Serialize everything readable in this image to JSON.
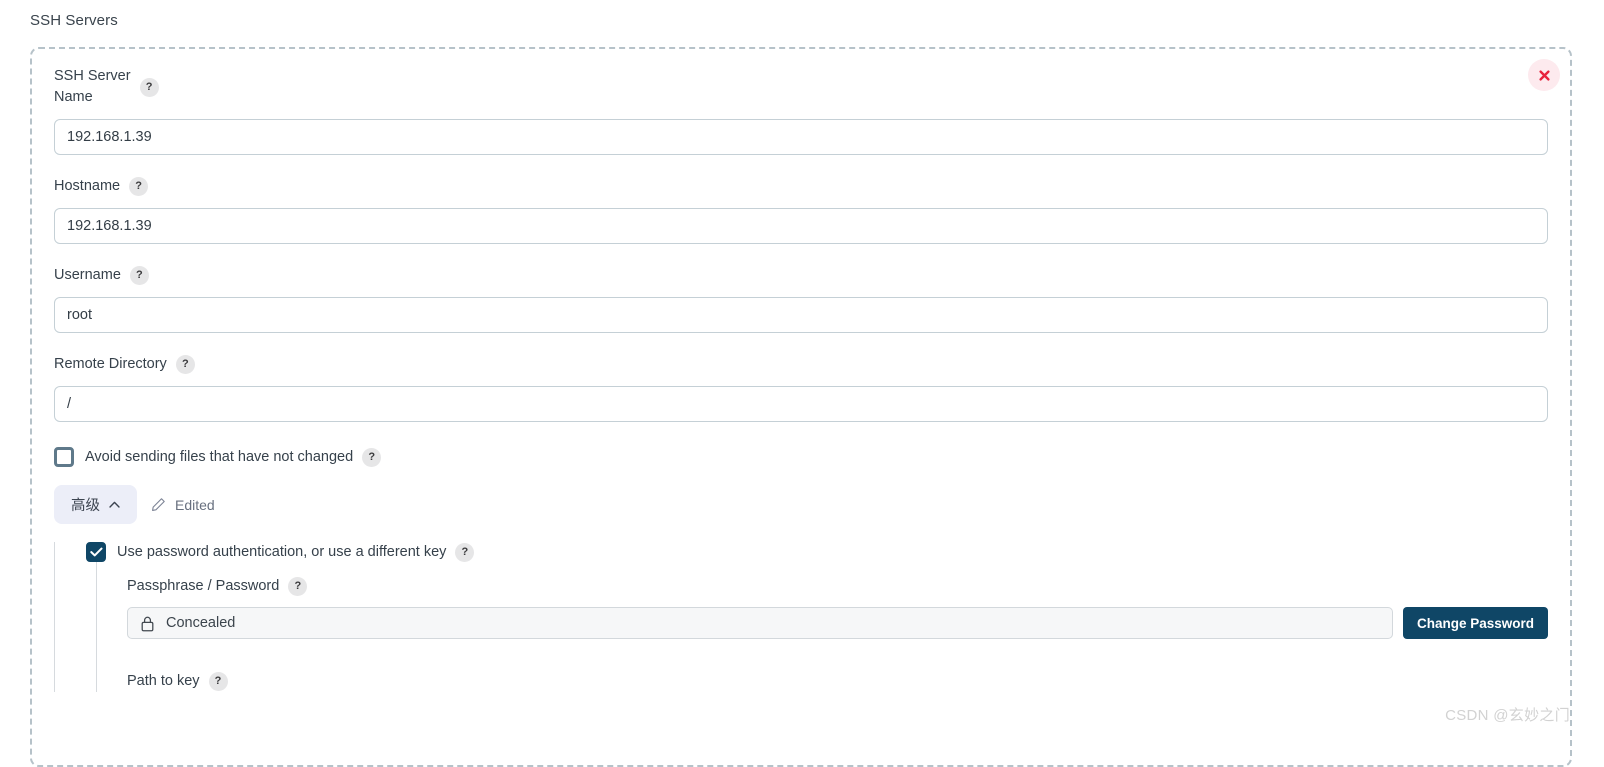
{
  "page": {
    "title": "SSH Servers"
  },
  "colors": {
    "accent_dark": "#0f4666",
    "dashed_border": "#b6c2c9",
    "close_bg": "#fdeaee",
    "close_fg": "#e8213b",
    "advanced_btn_bg": "#eceef8",
    "input_border": "#c5d0d6",
    "help_bg": "#e6e6e7",
    "checkbox_unchecked_border": "#5f798a"
  },
  "panel": {
    "close_label": "×",
    "close_icon": "close-icon",
    "fields": [
      {
        "label": "SSH Server\nName",
        "help": "?",
        "value": "192.168.1.39",
        "placeholder": "",
        "name": "ssh-server-name"
      },
      {
        "label": "Hostname",
        "help": "?",
        "value": "192.168.1.39",
        "placeholder": "",
        "name": "hostname"
      },
      {
        "label": "Username",
        "help": "?",
        "value": "root",
        "placeholder": "",
        "name": "username"
      },
      {
        "label": "Remote Directory",
        "help": "?",
        "value": "/",
        "placeholder": "",
        "name": "remote-directory"
      }
    ],
    "avoid_sending": {
      "label": "Avoid sending files that have not changed",
      "help": "?",
      "checked": false
    },
    "advanced": {
      "button_label": "高级",
      "chevron_icon": "chevron-up-icon",
      "edited_label": "Edited",
      "pencil_icon": "pencil-icon",
      "expanded": true,
      "password_auth": {
        "label": "Use password authentication, or use a different key",
        "help": "?",
        "checked": true
      },
      "passphrase": {
        "label": "Passphrase / Password",
        "help": "?",
        "value": "Concealed",
        "lock_icon": "lock-icon",
        "change_button_label": "Change Password"
      },
      "path_to_key": {
        "label": "Path to key",
        "help": "?"
      }
    }
  },
  "watermark": {
    "text": "CSDN @玄妙之门"
  }
}
